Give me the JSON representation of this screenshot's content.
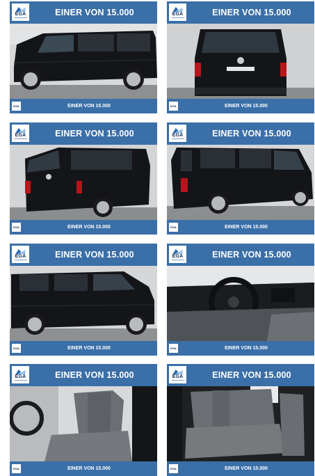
{
  "listing": {
    "brand_logo": "EGA",
    "cards": [
      {
        "banner": "EINER VON 15.000",
        "footer": "EINER VON 15.000",
        "view": "side-left"
      },
      {
        "banner": "EINER VON 15.000",
        "footer": "EINER VON 15.000",
        "view": "rear"
      },
      {
        "banner": "EINER VON 15.000",
        "footer": "EINER VON 15.000",
        "view": "rear-left"
      },
      {
        "banner": "EINER VON 15.000",
        "footer": "EINER VON 15.000",
        "view": "rear-right"
      },
      {
        "banner": "EINER VON 15.000",
        "footer": "EINER VON 15.000",
        "view": "side-right"
      },
      {
        "banner": "EINER VON 15.000",
        "footer": "EINER VON 15.000",
        "view": "dashboard"
      },
      {
        "banner": "EINER VON 15.000",
        "footer": "EINER VON 15.000",
        "view": "front-seats"
      },
      {
        "banner": "EINER VON 15.000",
        "footer": "EINER VON 15.000",
        "view": "rear-seats"
      }
    ]
  },
  "colors": {
    "banner": "#3a6fa8",
    "van": "#141519",
    "seat": "#6b6e72"
  }
}
